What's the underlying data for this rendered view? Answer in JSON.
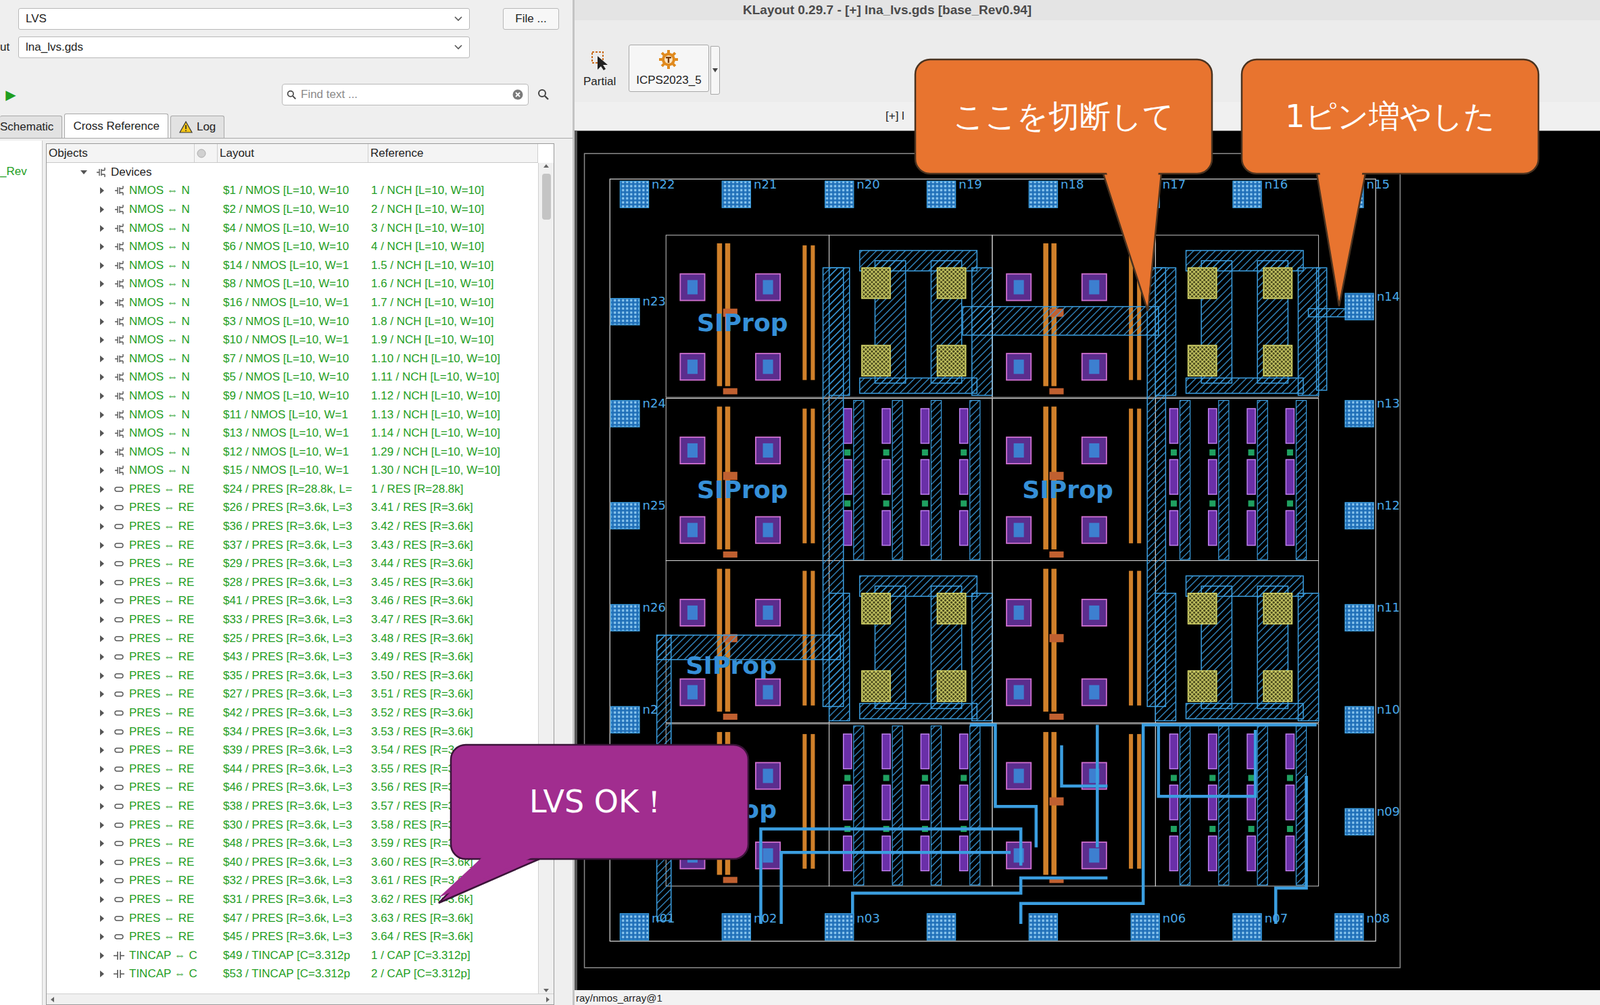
{
  "window": {
    "title": "KLayout 0.29.7 - [+] lna_lvs.gds [base_Rev0.94]"
  },
  "lvs_browser": {
    "tool_select": "LVS",
    "file_button": "File ...",
    "layout_label": "ut",
    "layout_select": "lna_lvs.gds",
    "run_button": "▶",
    "search": {
      "placeholder": "Find text ..."
    },
    "tabs": [
      {
        "label": "Schematic",
        "selected": false,
        "kind": "plain"
      },
      {
        "label": "Cross Reference",
        "selected": true,
        "kind": "plain"
      },
      {
        "label": "Log",
        "selected": false,
        "kind": "warning"
      }
    ],
    "sidebar": {
      "items": [
        {
          "label": "_Rev",
          "selected": false
        }
      ]
    },
    "table": {
      "columns": [
        "Objects",
        "Layout",
        "Reference"
      ],
      "group": {
        "label": "Devices",
        "expanded": true
      },
      "rows": [
        {
          "kind": "nmos",
          "object": "NMOS ⇔ N",
          "layout": "$1 / NMOS [L=10, W=10",
          "reference": "1 / NCH [L=10, W=10]",
          "expanded": false
        },
        {
          "kind": "nmos",
          "object": "NMOS ⇔ N",
          "layout": "$2 / NMOS [L=10, W=10",
          "reference": "2 / NCH [L=10, W=10]",
          "expanded": false
        },
        {
          "kind": "nmos",
          "object": "NMOS ⇔ N",
          "layout": "$4 / NMOS [L=10, W=10",
          "reference": "3 / NCH [L=10, W=10]",
          "expanded": false
        },
        {
          "kind": "nmos",
          "object": "NMOS ⇔ N",
          "layout": "$6 / NMOS [L=10, W=10",
          "reference": "4 / NCH [L=10, W=10]",
          "expanded": false
        },
        {
          "kind": "nmos",
          "object": "NMOS ⇔ N",
          "layout": "$14 / NMOS [L=10, W=1",
          "reference": "1.5 / NCH [L=10, W=10]",
          "expanded": false
        },
        {
          "kind": "nmos",
          "object": "NMOS ⇔ N",
          "layout": "$8 / NMOS [L=10, W=10",
          "reference": "1.6 / NCH [L=10, W=10]",
          "expanded": false
        },
        {
          "kind": "nmos",
          "object": "NMOS ⇔ N",
          "layout": "$16 / NMOS [L=10, W=1",
          "reference": "1.7 / NCH [L=10, W=10]",
          "expanded": false
        },
        {
          "kind": "nmos",
          "object": "NMOS ⇔ N",
          "layout": "$3 / NMOS [L=10, W=10",
          "reference": "1.8 / NCH [L=10, W=10]",
          "expanded": false
        },
        {
          "kind": "nmos",
          "object": "NMOS ⇔ N",
          "layout": "$10 / NMOS [L=10, W=1",
          "reference": "1.9 / NCH [L=10, W=10]",
          "expanded": false
        },
        {
          "kind": "nmos",
          "object": "NMOS ⇔ N",
          "layout": "$7 / NMOS [L=10, W=10",
          "reference": "1.10 / NCH [L=10, W=10]",
          "expanded": false
        },
        {
          "kind": "nmos",
          "object": "NMOS ⇔ N",
          "layout": "$5 / NMOS [L=10, W=10",
          "reference": "1.11 / NCH [L=10, W=10]",
          "expanded": false
        },
        {
          "kind": "nmos",
          "object": "NMOS ⇔ N",
          "layout": "$9 / NMOS [L=10, W=10",
          "reference": "1.12 / NCH [L=10, W=10]",
          "expanded": false
        },
        {
          "kind": "nmos",
          "object": "NMOS ⇔ N",
          "layout": "$11 / NMOS [L=10, W=1",
          "reference": "1.13 / NCH [L=10, W=10]",
          "expanded": false
        },
        {
          "kind": "nmos",
          "object": "NMOS ⇔ N",
          "layout": "$13 / NMOS [L=10, W=1",
          "reference": "1.14 / NCH [L=10, W=10]",
          "expanded": false
        },
        {
          "kind": "nmos",
          "object": "NMOS ⇔ N",
          "layout": "$12 / NMOS [L=10, W=1",
          "reference": "1.29 / NCH [L=10, W=10]",
          "expanded": false
        },
        {
          "kind": "nmos",
          "object": "NMOS ⇔ N",
          "layout": "$15 / NMOS [L=10, W=1",
          "reference": "1.30 / NCH [L=10, W=10]",
          "expanded": false
        },
        {
          "kind": "pres",
          "object": "PRES ⇔ RE",
          "layout": "$24 / PRES [R=28.8k, L=",
          "reference": "1 / RES [R=28.8k]",
          "expanded": false
        },
        {
          "kind": "pres",
          "object": "PRES ⇔ RE",
          "layout": "$26 / PRES [R=3.6k, L=3",
          "reference": "3.41 / RES [R=3.6k]",
          "expanded": false
        },
        {
          "kind": "pres",
          "object": "PRES ⇔ RE",
          "layout": "$36 / PRES [R=3.6k, L=3",
          "reference": "3.42 / RES [R=3.6k]",
          "expanded": false
        },
        {
          "kind": "pres",
          "object": "PRES ⇔ RE",
          "layout": "$37 / PRES [R=3.6k, L=3",
          "reference": "3.43 / RES [R=3.6k]",
          "expanded": false
        },
        {
          "kind": "pres",
          "object": "PRES ⇔ RE",
          "layout": "$29 / PRES [R=3.6k, L=3",
          "reference": "3.44 / RES [R=3.6k]",
          "expanded": false
        },
        {
          "kind": "pres",
          "object": "PRES ⇔ RE",
          "layout": "$28 / PRES [R=3.6k, L=3",
          "reference": "3.45 / RES [R=3.6k]",
          "expanded": false
        },
        {
          "kind": "pres",
          "object": "PRES ⇔ RE",
          "layout": "$41 / PRES [R=3.6k, L=3",
          "reference": "3.46 / RES [R=3.6k]",
          "expanded": false
        },
        {
          "kind": "pres",
          "object": "PRES ⇔ RE",
          "layout": "$33 / PRES [R=3.6k, L=3",
          "reference": "3.47 / RES [R=3.6k]",
          "expanded": false
        },
        {
          "kind": "pres",
          "object": "PRES ⇔ RE",
          "layout": "$25 / PRES [R=3.6k, L=3",
          "reference": "3.48 / RES [R=3.6k]",
          "expanded": false
        },
        {
          "kind": "pres",
          "object": "PRES ⇔ RE",
          "layout": "$43 / PRES [R=3.6k, L=3",
          "reference": "3.49 / RES [R=3.6k]",
          "expanded": false
        },
        {
          "kind": "pres",
          "object": "PRES ⇔ RE",
          "layout": "$35 / PRES [R=3.6k, L=3",
          "reference": "3.50 / RES [R=3.6k]",
          "expanded": false
        },
        {
          "kind": "pres",
          "object": "PRES ⇔ RE",
          "layout": "$27 / PRES [R=3.6k, L=3",
          "reference": "3.51 / RES [R=3.6k]",
          "expanded": false
        },
        {
          "kind": "pres",
          "object": "PRES ⇔ RE",
          "layout": "$42 / PRES [R=3.6k, L=3",
          "reference": "3.52 / RES [R=3.6k]",
          "expanded": false
        },
        {
          "kind": "pres",
          "object": "PRES ⇔ RE",
          "layout": "$34 / PRES [R=3.6k, L=3",
          "reference": "3.53 / RES [R=3.6k]",
          "expanded": false
        },
        {
          "kind": "pres",
          "object": "PRES ⇔ RE",
          "layout": "$39 / PRES [R=3.6k, L=3",
          "reference": "3.54 / RES [R=3.6k]",
          "expanded": false
        },
        {
          "kind": "pres",
          "object": "PRES ⇔ RE",
          "layout": "$44 / PRES [R=3.6k, L=3",
          "reference": "3.55 / RES [R=3.6k]",
          "expanded": false
        },
        {
          "kind": "pres",
          "object": "PRES ⇔ RE",
          "layout": "$46 / PRES [R=3.6k, L=3",
          "reference": "3.56 / RES [R=3.6k]",
          "expanded": false
        },
        {
          "kind": "pres",
          "object": "PRES ⇔ RE",
          "layout": "$38 / PRES [R=3.6k, L=3",
          "reference": "3.57 / RES [R=3.6k]",
          "expanded": false
        },
        {
          "kind": "pres",
          "object": "PRES ⇔ RE",
          "layout": "$30 / PRES [R=3.6k, L=3",
          "reference": "3.58 / RES [R=3.6k]",
          "expanded": false
        },
        {
          "kind": "pres",
          "object": "PRES ⇔ RE",
          "layout": "$48 / PRES [R=3.6k, L=3",
          "reference": "3.59 / RES [R=3.6k]",
          "expanded": false
        },
        {
          "kind": "pres",
          "object": "PRES ⇔ RE",
          "layout": "$40 / PRES [R=3.6k, L=3",
          "reference": "3.60 / RES [R=3.6k]",
          "expanded": false
        },
        {
          "kind": "pres",
          "object": "PRES ⇔ RE",
          "layout": "$32 / PRES [R=3.6k, L=3",
          "reference": "3.61 / RES [R=3.6k]",
          "expanded": false
        },
        {
          "kind": "pres",
          "object": "PRES ⇔ RE",
          "layout": "$31 / PRES [R=3.6k, L=3",
          "reference": "3.62 / RES [R=3.6k]",
          "expanded": false
        },
        {
          "kind": "pres",
          "object": "PRES ⇔ RE",
          "layout": "$47 / PRES [R=3.6k, L=3",
          "reference": "3.63 / RES [R=3.6k]",
          "expanded": false
        },
        {
          "kind": "pres",
          "object": "PRES ⇔ RE",
          "layout": "$45 / PRES [R=3.6k, L=3",
          "reference": "3.64 / RES [R=3.6k]",
          "expanded": false
        },
        {
          "kind": "tincap",
          "object": "TINCAP ⇔ C",
          "layout": "$49 / TINCAP [C=3.312p",
          "reference": "1 / CAP [C=3.312p]",
          "expanded": false
        },
        {
          "kind": "tincap",
          "object": "TINCAP ⇔ C",
          "layout": "$53 / TINCAP [C=3.312p",
          "reference": "2 / CAP [C=3.312p]",
          "expanded": false
        }
      ]
    }
  },
  "toolbar": {
    "buttons": [
      "Partial",
      "ICPS2023_5"
    ]
  },
  "layout_view": {
    "tab": "[+] l",
    "cell_labels": [
      "SIProp",
      "SIProp",
      "SIProp",
      "SIProp",
      "SIProp"
    ],
    "pins": {
      "top": [
        {
          "label": "n22"
        },
        {
          "label": "n21"
        },
        {
          "label": "n20"
        },
        {
          "label": "n19"
        },
        {
          "label": "n18"
        },
        {
          "label": "n17"
        },
        {
          "label": "n16"
        },
        {
          "label": "n15"
        }
      ],
      "left": [
        {
          "label": "n23"
        },
        {
          "label": "n24"
        },
        {
          "label": "n25"
        },
        {
          "label": "n26"
        },
        {
          "label": "n2"
        }
      ],
      "right": [
        {
          "label": "n14"
        },
        {
          "label": "n13"
        },
        {
          "label": "n12"
        },
        {
          "label": "n11"
        },
        {
          "label": "n10"
        },
        {
          "label": "n09"
        }
      ],
      "bottom": [
        {
          "label": "n01"
        },
        {
          "label": "n02"
        },
        {
          "label": "n03"
        },
        {
          "label": null
        },
        {
          "label": null
        },
        {
          "label": "n06"
        },
        {
          "label": "n07"
        },
        {
          "label": "n08"
        }
      ]
    }
  },
  "callouts": [
    {
      "text": "ここを切断して",
      "color": "#e8742f"
    },
    {
      "text": "1ピン増やした",
      "color": "#e8742f"
    },
    {
      "text": "LVS OK！",
      "color": "#a12d8f"
    }
  ],
  "status_bar": "ray/nmos_array@1"
}
